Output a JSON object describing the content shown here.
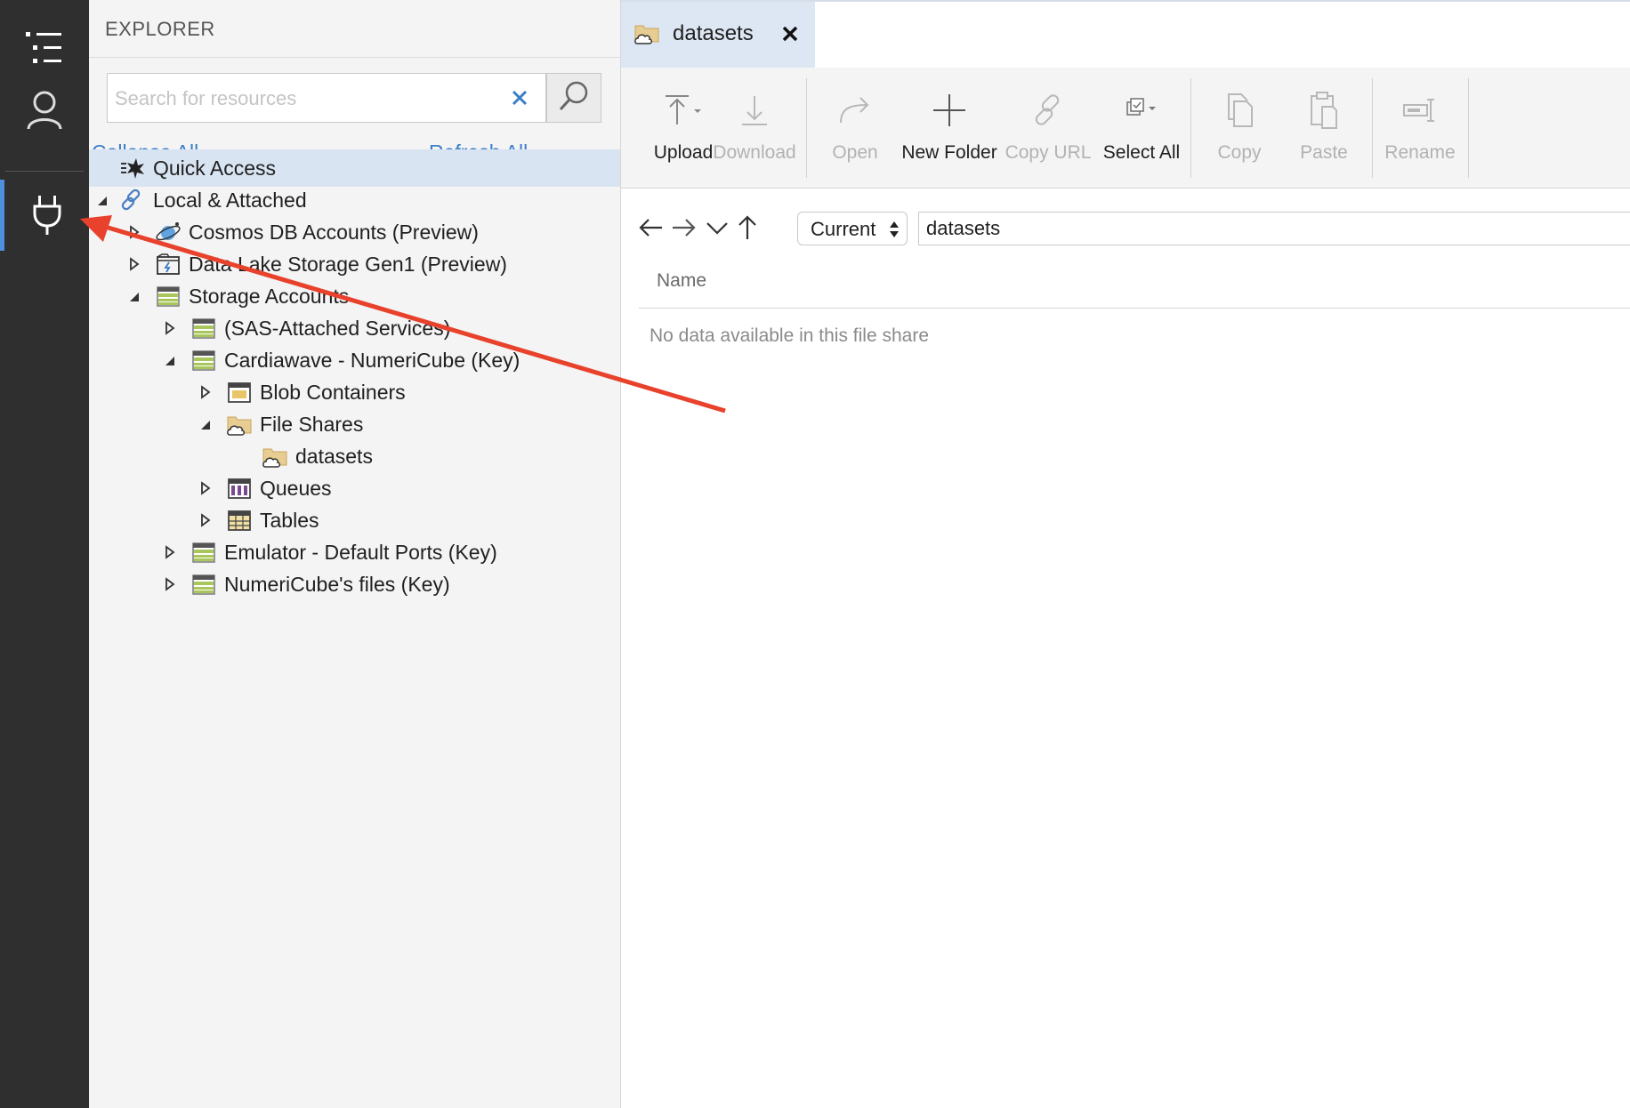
{
  "activity_bar": {
    "items": [
      {
        "name": "explorer-icon"
      },
      {
        "name": "account-icon"
      },
      {
        "name": "connect-plug-icon",
        "active": true
      }
    ]
  },
  "explorer": {
    "title": "EXPLORER",
    "search": {
      "placeholder": "Search for resources",
      "value": ""
    },
    "collapse_all": "Collapse All",
    "refresh_all": "Refresh All",
    "tree": [
      {
        "label": "Quick Access",
        "icon": "quick-access-icon",
        "selected": true
      },
      {
        "label": "Local & Attached",
        "icon": "link-icon",
        "expander": "expanded"
      },
      {
        "label": "Cosmos DB Accounts (Preview)",
        "icon": "cosmos-db-icon",
        "expander": "collapsed"
      },
      {
        "label": "Data Lake Storage Gen1 (Preview)",
        "icon": "data-lake-icon",
        "expander": "collapsed"
      },
      {
        "label": "Storage Accounts",
        "icon": "storage-account-icon",
        "expander": "expanded"
      },
      {
        "label": "(SAS-Attached Services)",
        "icon": "storage-account-icon",
        "expander": "collapsed"
      },
      {
        "label": "Cardiawave - NumeriCube (Key)",
        "icon": "storage-account-icon",
        "expander": "expanded"
      },
      {
        "label": "Blob Containers",
        "icon": "blob-container-icon",
        "expander": "collapsed"
      },
      {
        "label": "File Shares",
        "icon": "file-share-icon",
        "expander": "expanded"
      },
      {
        "label": "datasets",
        "icon": "file-share-icon"
      },
      {
        "label": "Queues",
        "icon": "queue-icon",
        "expander": "collapsed"
      },
      {
        "label": "Tables",
        "icon": "table-icon",
        "expander": "collapsed"
      },
      {
        "label": "Emulator - Default Ports (Key)",
        "icon": "storage-account-icon",
        "expander": "collapsed"
      },
      {
        "label": "NumeriCube's files (Key)",
        "icon": "storage-account-icon",
        "expander": "collapsed"
      }
    ]
  },
  "tab": {
    "label": "datasets",
    "icon": "file-share-icon"
  },
  "toolbar": {
    "upload": "Upload",
    "download": "Download",
    "open": "Open",
    "new_folder": "New Folder",
    "copy_url": "Copy URL",
    "select_all": "Select All",
    "copy": "Copy",
    "paste": "Paste",
    "rename": "Rename"
  },
  "navigation": {
    "scope": "Current",
    "path": "datasets"
  },
  "grid": {
    "column_name": "Name",
    "empty_message": "No data available in this file share"
  },
  "colors": {
    "accent": "#3b7ec8",
    "annotation_arrow": "#e8412c",
    "selected_row": "#d9e4f2",
    "activity_bar": "#2f2f2f"
  }
}
